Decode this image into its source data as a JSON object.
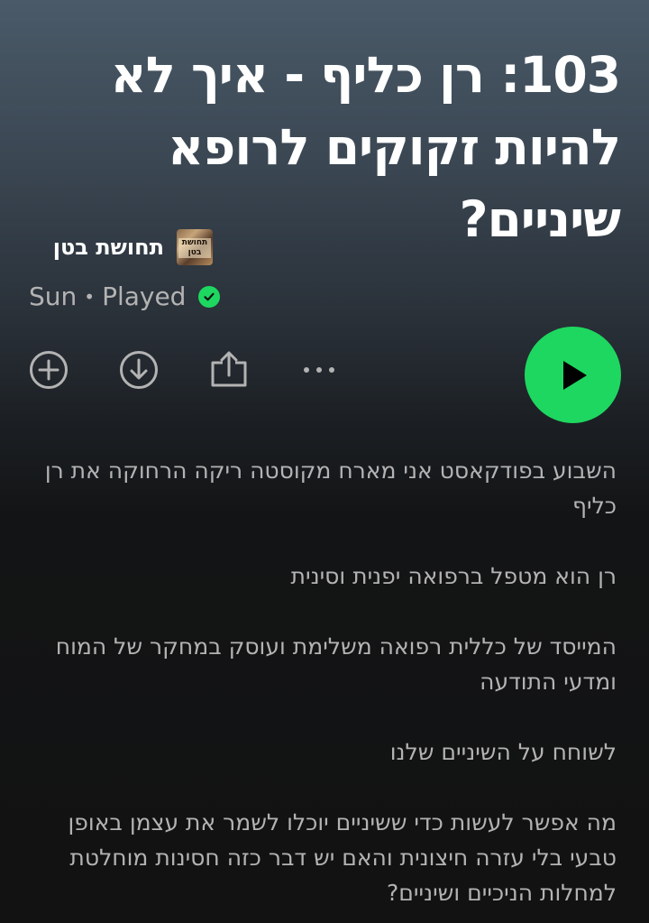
{
  "episode": {
    "title": "103: רן כליף - איך לא להיות זקוקים לרופא שיניים?"
  },
  "show": {
    "name": "תחושת בטן",
    "thumb_text": "תחושת בטן"
  },
  "meta": {
    "day": "Sun",
    "separator": "•",
    "status": "Played"
  },
  "actions": {
    "add_icon": "plus-circle-icon",
    "download_icon": "download-circle-icon",
    "share_icon": "share-icon",
    "more_icon": "more-horizontal-icon",
    "play_icon": "play-icon"
  },
  "colors": {
    "accent": "#1ed760",
    "text_secondary": "#b3b3b3",
    "background": "#121212"
  },
  "description": {
    "paragraphs": [
      "השבוע בפודקאסט אני מארח מקוסטה ריקה הרחוקה את רן כליף",
      "רן הוא מטפל ברפואה יפנית וסינית",
      "המייסד של כללית רפואה משלימת ועוסק במחקר של המוח ומדעי התודעה",
      "לשוחח על השיניים שלנו",
      "מה אפשר לעשות כדי ששיניים יוכלו לשמר את עצמן באופן טבעי בלי עזרה חיצונית והאם יש דבר כזה חסינות מוחלטת למחלות הניכיים ושיניים?"
    ]
  }
}
